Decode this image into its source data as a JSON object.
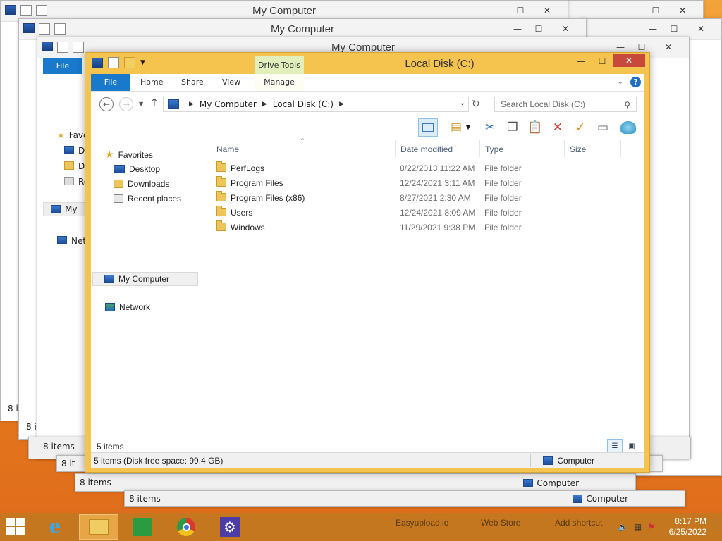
{
  "background_windows": [
    {
      "title": "My Computer",
      "status": "8 items"
    },
    {
      "title": "My Computer",
      "status": "8 items",
      "status_right": "Computer"
    },
    {
      "title": "My Computer",
      "status": "8 items",
      "status_right": "Computer"
    }
  ],
  "background_sidebar": {
    "file_tab": "File",
    "favorites": "Favo",
    "items": [
      "De",
      "Do",
      "Re"
    ],
    "my": "My",
    "network": "Netw",
    "count_a": "8 items",
    "count_b": "8 it",
    "count_c": "8 it",
    "count_d": "8 it"
  },
  "window": {
    "title": "Local Disk (C:)",
    "context_tab": "Drive Tools",
    "tabs": {
      "file": "File",
      "home": "Home",
      "share": "Share",
      "view": "View",
      "manage": "Manage"
    },
    "help": "?",
    "address": {
      "root": "My Computer",
      "current": "Local Disk (C:)"
    },
    "search_placeholder": "Search Local Disk (C:)",
    "nav": {
      "favorites": "Favorites",
      "desktop": "Desktop",
      "downloads": "Downloads",
      "recent": "Recent places",
      "mycomputer": "My Computer",
      "network": "Network"
    },
    "columns": {
      "name": "Name",
      "date": "Date modified",
      "type": "Type",
      "size": "Size"
    },
    "files": [
      {
        "name": "PerfLogs",
        "date": "8/22/2013 11:22 AM",
        "type": "File folder"
      },
      {
        "name": "Program Files",
        "date": "12/24/2021 3:11 AM",
        "type": "File folder"
      },
      {
        "name": "Program Files (x86)",
        "date": "8/27/2021 2:30 AM",
        "type": "File folder"
      },
      {
        "name": "Users",
        "date": "12/24/2021 8:09 AM",
        "type": "File folder"
      },
      {
        "name": "Windows",
        "date": "11/29/2021 9:38 PM",
        "type": "File folder"
      }
    ],
    "item_count": "5 items",
    "status_left": "5 items (Disk free space: 99.4 GB)",
    "status_right": "Computer"
  },
  "taskbar": {
    "links": [
      "Easyupload.io",
      "Web Store",
      "Add shortcut"
    ],
    "time": "8:17 PM",
    "date": "6/25/2022"
  },
  "colors": {
    "accent": "#1979ca",
    "window_frame": "#f5c44f",
    "taskbar": "#c4771e",
    "close": "#c7493b"
  }
}
